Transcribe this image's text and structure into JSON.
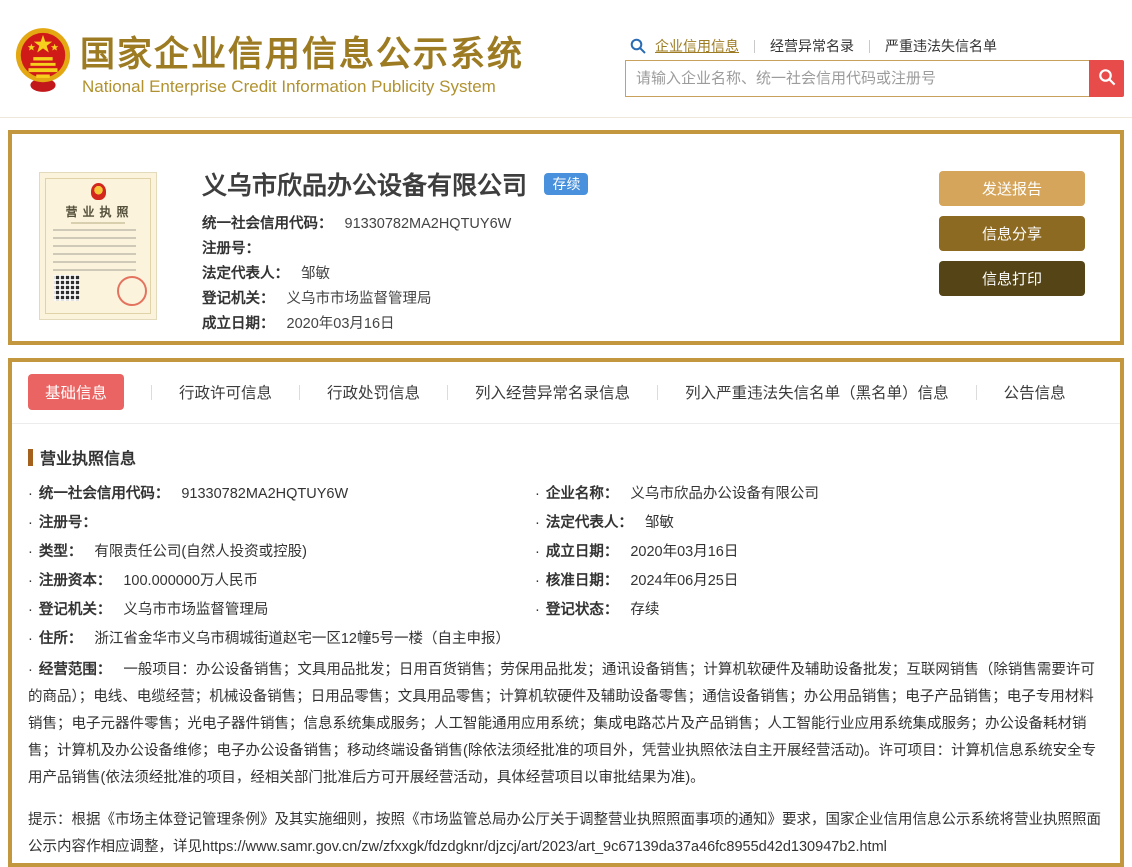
{
  "ui": {
    "bullet": "·"
  },
  "colors": {
    "brand_gold": "#9c7b22",
    "card_border": "#c2973e",
    "search_button_red": "#e84c4a",
    "active_tab_red": "#e96462",
    "status_badge_blue": "#4a91dd",
    "button_send_report": "#d5a55b",
    "button_info_share": "#8d6a22",
    "button_info_print": "#544416"
  },
  "header": {
    "title": "国家企业信用信息公示系统",
    "subtitle": "National Enterprise Credit Information Publicity System",
    "links": [
      {
        "label": "企业信用信息"
      },
      {
        "label": "经营异常名录"
      },
      {
        "label": "严重违法失信名单"
      }
    ],
    "search_placeholder": "请输入企业名称、统一社会信用代码或注册号"
  },
  "summary": {
    "license_thumb_label": "营业执照",
    "company_name": "义乌市欣品办公设备有限公司",
    "status": "存续",
    "fields": [
      {
        "label": "统一社会信用代码：",
        "value": "91330782MA2HQTUY6W"
      },
      {
        "label": "注册号：",
        "value": ""
      },
      {
        "label": "法定代表人：",
        "value": "邹敏"
      },
      {
        "label": "登记机关：",
        "value": "义乌市市场监督管理局"
      },
      {
        "label": "成立日期：",
        "value": "2020年03月16日"
      }
    ],
    "actions": [
      {
        "label": "发送报告"
      },
      {
        "label": "信息分享"
      },
      {
        "label": "信息打印"
      }
    ]
  },
  "tabs": [
    {
      "label": "基础信息"
    },
    {
      "label": "行政许可信息"
    },
    {
      "label": "行政处罚信息"
    },
    {
      "label": "列入经营异常名录信息"
    },
    {
      "label": "列入严重违法失信名单（黑名单）信息"
    },
    {
      "label": "公告信息"
    }
  ],
  "detail": {
    "section_title": "营业执照信息",
    "fields": [
      {
        "label": "统一社会信用代码：",
        "value": "91330782MA2HQTUY6W"
      },
      {
        "label": "企业名称：",
        "value": "义乌市欣品办公设备有限公司"
      },
      {
        "label": "注册号：",
        "value": ""
      },
      {
        "label": "法定代表人：",
        "value": "邹敏"
      },
      {
        "label": "类型：",
        "value": "有限责任公司(自然人投资或控股)"
      },
      {
        "label": "成立日期：",
        "value": "2020年03月16日"
      },
      {
        "label": "注册资本：",
        "value": "100.000000万人民币"
      },
      {
        "label": "核准日期：",
        "value": "2024年06月25日"
      },
      {
        "label": "登记机关：",
        "value": "义乌市市场监督管理局"
      },
      {
        "label": "登记状态：",
        "value": "存续"
      }
    ],
    "address": {
      "label": "住所：",
      "value": "浙江省金华市义乌市稠城街道赵宅一区12幢5号一楼（自主申报）"
    },
    "scope": {
      "label": "经营范围：",
      "value": "一般项目：办公设备销售；文具用品批发；日用百货销售；劳保用品批发；通讯设备销售；计算机软硬件及辅助设备批发；互联网销售（除销售需要许可的商品）；电线、电缆经营；机械设备销售；日用品零售；文具用品零售；计算机软硬件及辅助设备零售；通信设备销售；办公用品销售；电子产品销售；电子专用材料销售；电子元器件零售；光电子器件销售；信息系统集成服务；人工智能通用应用系统；集成电路芯片及产品销售；人工智能行业应用系统集成服务；办公设备耗材销售；计算机及办公设备维修；电子办公设备销售；移动终端设备销售(除依法须经批准的项目外，凭营业执照依法自主开展经营活动)。许可项目：计算机信息系统安全专用产品销售(依法须经批准的项目，经相关部门批准后方可开展经营活动，具体经营项目以审批结果为准)。"
    },
    "notice": "提示：根据《市场主体登记管理条例》及其实施细则，按照《市场监管总局办公厅关于调整营业执照照面事项的通知》要求，国家企业信用信息公示系统将营业执照照面公示内容作相应调整，详见https://www.samr.gov.cn/zw/zfxxgk/fdzdgknr/djzcj/art/2023/art_9c67139da37a46fc8955d42d130947b2.html"
  }
}
